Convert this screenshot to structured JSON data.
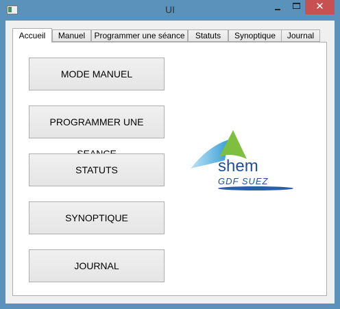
{
  "window": {
    "title": "UI",
    "close_label": "✕"
  },
  "tabs": [
    {
      "label": "Accueil"
    },
    {
      "label": "Manuel"
    },
    {
      "label": "Programmer une séance"
    },
    {
      "label": "Statuts"
    },
    {
      "label": "Synoptique"
    },
    {
      "label": "Journal"
    }
  ],
  "buttons": [
    {
      "label": "MODE MANUEL"
    },
    {
      "label": "PROGRAMMER UNE SEANCE"
    },
    {
      "label": "STATUTS"
    },
    {
      "label": "SYNOPTIQUE"
    },
    {
      "label": "JOURNAL"
    }
  ],
  "logo": {
    "name": "shem",
    "subtitle": "GDF SUEZ"
  }
}
